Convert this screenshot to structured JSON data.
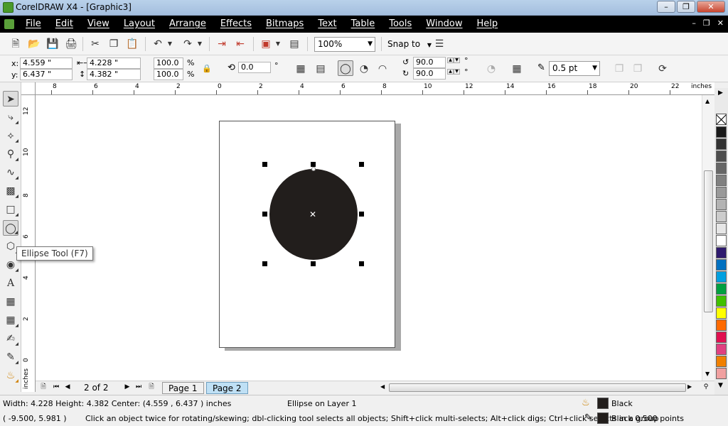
{
  "window": {
    "title": "CorelDRAW X4 - [Graphic3]"
  },
  "menu": [
    "File",
    "Edit",
    "View",
    "Layout",
    "Arrange",
    "Effects",
    "Bitmaps",
    "Text",
    "Table",
    "Tools",
    "Window",
    "Help"
  ],
  "standard_toolbar": {
    "zoom": "100%",
    "snap_label": "Snap to"
  },
  "property_bar": {
    "x_label": "x:",
    "x_value": "4.559 \"",
    "y_label": "y:",
    "y_value": "6.437 \"",
    "width_value": "4.228 \"",
    "height_value": "4.382 \"",
    "scale_x": "100.0",
    "scale_y": "100.0",
    "percent": "%",
    "rotation": "0.0",
    "degree": "°",
    "start_angle": "90.0",
    "end_angle": "90.0",
    "outline_width": "0.5 pt"
  },
  "rulers": {
    "horizontal": [
      "8",
      "6",
      "4",
      "2",
      "0",
      "2",
      "4",
      "6",
      "8",
      "10",
      "12",
      "14",
      "16",
      "18",
      "20",
      "22"
    ],
    "vertical": [
      "12",
      "10",
      "8",
      "6",
      "4",
      "2",
      "0"
    ],
    "unit": "inches",
    "vertical_unit": "inches"
  },
  "tooltip": "Ellipse Tool (F7)",
  "navigator": {
    "page_count": "2 of 2",
    "tabs": [
      {
        "label": "Page 1",
        "active": false
      },
      {
        "label": "Page 2",
        "active": true
      }
    ]
  },
  "status": {
    "dimensions": "Width: 4.228  Height: 4.382  Center: (4.559 , 6.437 )  inches",
    "object_info": "Ellipse on Layer 1",
    "fill_label": "Black",
    "cursor_coords": "( -9.500, 5.981 )",
    "hint": "Click an object twice for rotating/skewing; dbl-clicking tool selects all objects; Shift+click multi-selects; Alt+click digs; Ctrl+click selects in a group",
    "outline_label": "Black  0.500 points"
  },
  "colors": {
    "object_fill": "#221e1c",
    "palette": [
      "#1a1a1a",
      "#333333",
      "#4d4d4d",
      "#666666",
      "#808080",
      "#999999",
      "#b3b3b3",
      "#cccccc",
      "#e6e6e6",
      "#ffffff",
      "#2e1a6e",
      "#0070c0",
      "#00a0e0",
      "#00a040",
      "#40c000",
      "#ffff00",
      "#ff6a00",
      "#e01050",
      "#e04080",
      "#f08000",
      "#f0a0a0"
    ]
  }
}
